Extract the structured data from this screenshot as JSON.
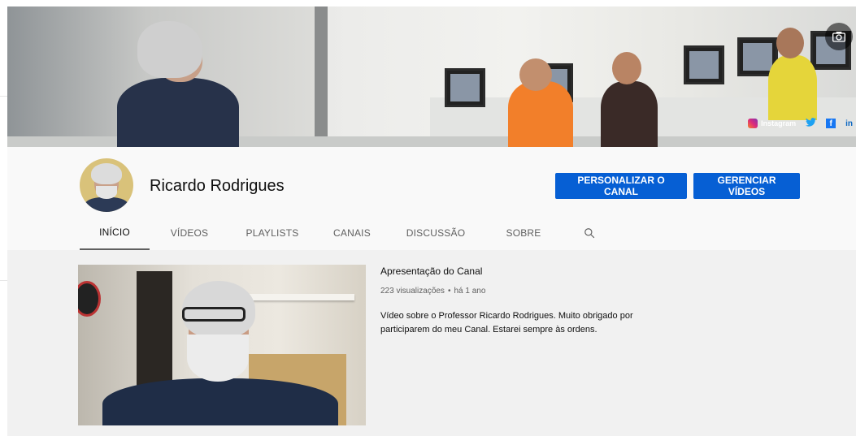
{
  "banner": {
    "social": {
      "instagram_label": "Instagram",
      "twitter_glyph": "🐦",
      "facebook_glyph": "f",
      "linkedin_glyph": "in"
    },
    "camera_icon": "camera-icon"
  },
  "channel": {
    "name": "Ricardo Rodrigues",
    "customize_label": "PERSONALIZAR O CANAL",
    "manage_label": "GERENCIAR VÍDEOS"
  },
  "tabs": [
    {
      "label": "INÍCIO",
      "active": true
    },
    {
      "label": "VÍDEOS",
      "active": false
    },
    {
      "label": "PLAYLISTS",
      "active": false
    },
    {
      "label": "CANAIS",
      "active": false
    },
    {
      "label": "DISCUSSÃO",
      "active": false
    },
    {
      "label": "SOBRE",
      "active": false
    }
  ],
  "featured_video": {
    "title": "Apresentação do Canal",
    "views": "223 visualizações",
    "separator": "•",
    "age": "há 1 ano",
    "description": "Vídeo sobre o Professor Ricardo Rodrigues. Muito obrigado por participarem do meu Canal. Estarei sempre às ordens."
  },
  "colors": {
    "accent": "#065fd4",
    "tab_underline": "#606060",
    "header_bg": "#f9f9f9",
    "content_bg": "#f1f1f1"
  }
}
